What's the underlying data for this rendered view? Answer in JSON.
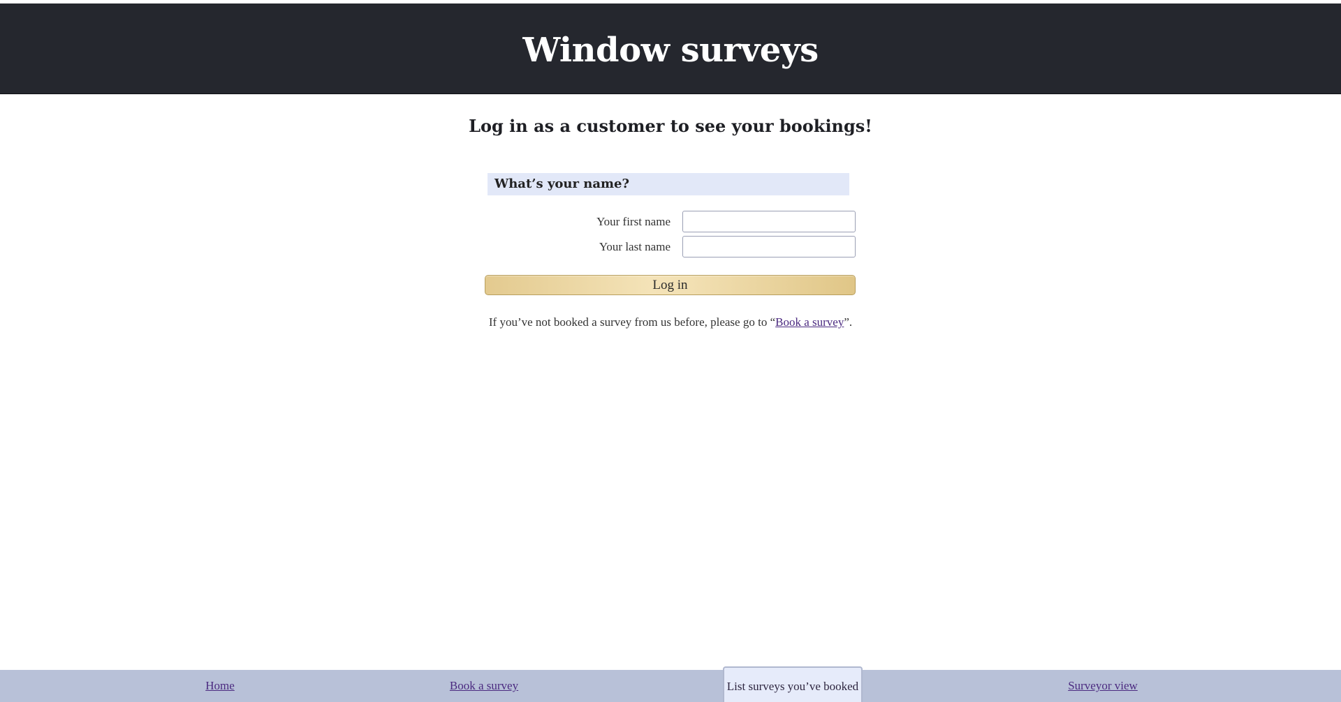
{
  "header": {
    "title": "Window surveys"
  },
  "main": {
    "subtitle": "Log in as a customer to see your bookings!",
    "form": {
      "legend": "What’s your name?",
      "first_name_label": "Your first name",
      "first_name_value": "",
      "last_name_label": "Your last name",
      "last_name_value": "",
      "submit_label": "Log in"
    },
    "note": {
      "before": "If you’ve not booked a survey from us before, please go to “",
      "link_text": "Book a survey",
      "after": "”."
    }
  },
  "nav": {
    "items": [
      {
        "label": "Home",
        "active": false
      },
      {
        "label": "Book a survey",
        "active": false
      },
      {
        "label": "List surveys you’ve booked",
        "active": true
      },
      {
        "label": "Surveyor view",
        "active": false
      }
    ]
  },
  "colors": {
    "header_bg": "#25272e",
    "legend_bg": "#e2e8f8",
    "button_gold": "#e3ca8f",
    "nav_bg": "#b8c1d8",
    "nav_active_bg": "#e6ebfa",
    "link": "#4b2a80"
  }
}
